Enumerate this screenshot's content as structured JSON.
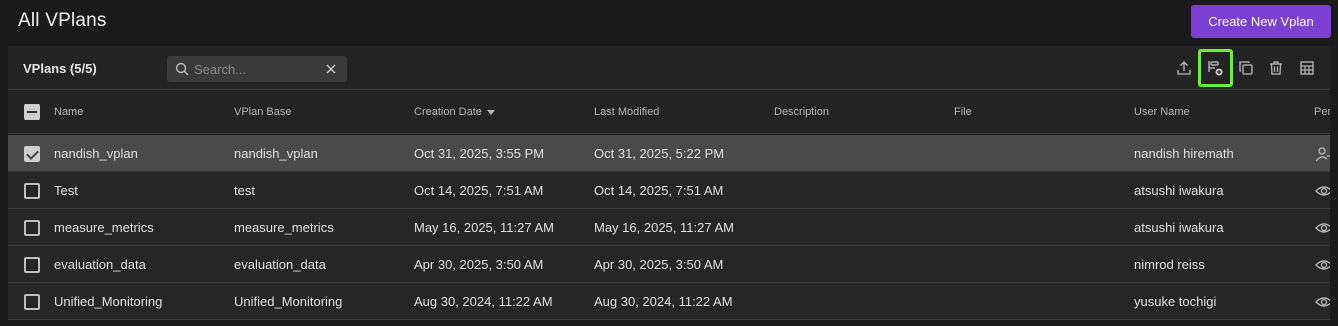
{
  "header": {
    "title": "All VPlans",
    "create_button": "Create New Vplan"
  },
  "toolbar": {
    "count_label": "VPlans (5/5)",
    "search_placeholder": "Search...",
    "actions": [
      "upload-icon",
      "add-to-plan-icon",
      "copy-icon",
      "delete-icon",
      "table-columns-icon"
    ]
  },
  "table": {
    "columns": [
      "Name",
      "VPlan Base",
      "Creation Date",
      "Last Modified",
      "Description",
      "File",
      "User Name",
      "Per"
    ],
    "sort": {
      "column": "Creation Date",
      "direction": "desc"
    },
    "rows": [
      {
        "checked": true,
        "name": "nandish_vplan",
        "base": "nandish_vplan",
        "created": "Oct 31, 2025, 3:55 PM",
        "modified": "Oct 31, 2025, 5:22 PM",
        "description": "",
        "file": "",
        "user": "nandish hiremath",
        "perm_icon": "user-edit-icon"
      },
      {
        "checked": false,
        "name": "Test",
        "base": "test",
        "created": "Oct 14, 2025, 7:51 AM",
        "modified": "Oct 14, 2025, 7:51 AM",
        "description": "",
        "file": "",
        "user": "atsushi iwakura",
        "perm_icon": "eye-icon"
      },
      {
        "checked": false,
        "name": "measure_metrics",
        "base": "measure_metrics",
        "created": "May 16, 2025, 11:27 AM",
        "modified": "May 16, 2025, 11:27 AM",
        "description": "",
        "file": "",
        "user": "atsushi iwakura",
        "perm_icon": "eye-icon"
      },
      {
        "checked": false,
        "name": "evaluation_data",
        "base": "evaluation_data",
        "created": "Apr 30, 2025, 3:50 AM",
        "modified": "Apr 30, 2025, 3:50 AM",
        "description": "",
        "file": "",
        "user": "nimrod reiss",
        "perm_icon": "eye-icon"
      },
      {
        "checked": false,
        "name": "Unified_Monitoring",
        "base": "Unified_Monitoring",
        "created": "Aug 30, 2024, 11:22 AM",
        "modified": "Aug 30, 2024, 11:22 AM",
        "description": "",
        "file": "",
        "user": "yusuke tochigi",
        "perm_icon": "eye-icon"
      }
    ]
  },
  "colors": {
    "accent": "#7b3fd1",
    "highlight": "#6cf03a",
    "selected_row": "#4a4a4a"
  }
}
